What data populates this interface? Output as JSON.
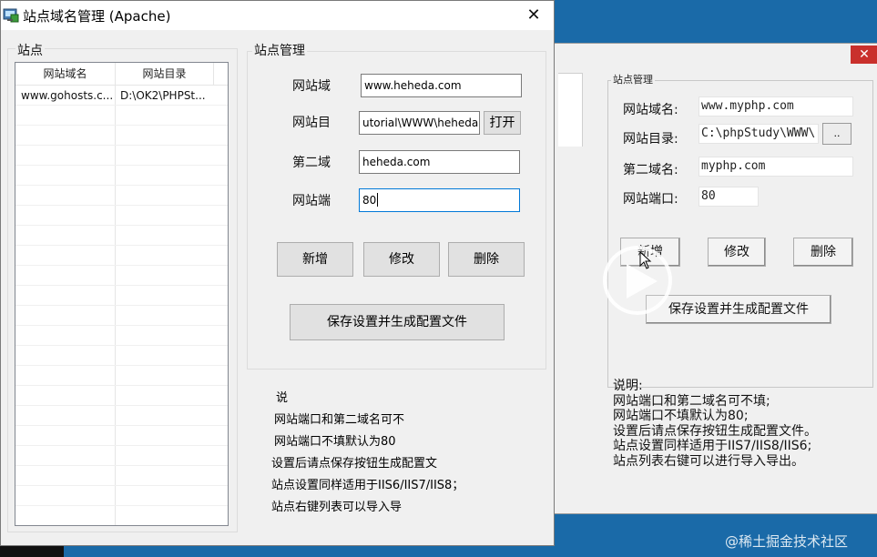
{
  "window": {
    "title": "站点域名管理 (Apache)"
  },
  "site_list": {
    "group_title": "站点",
    "columns": [
      "网站域名",
      "网站目录"
    ],
    "rows": [
      [
        "www.gohosts.c...",
        "D:\\OK2\\PHPSt..."
      ]
    ]
  },
  "site_manage": {
    "group_title": "站点管理",
    "domain_label": "网站域",
    "domain_value": "www.heheda.com",
    "dir_label": "网站目",
    "dir_value": "utorial\\WWW\\heheda",
    "open_button": "打开",
    "second_domain_label": "第二域",
    "second_domain_value": "heheda.com",
    "port_label": "网站端",
    "port_value": "80",
    "add_button": "新增",
    "edit_button": "修改",
    "delete_button": "删除",
    "save_button": "保存设置并生成配置文件"
  },
  "notes": [
    "说",
    "网站端口和第二域名可不",
    "网站端口不填默认为80",
    "设置后请点保存按钮生成配置文",
    "站点设置同样适用于IIS6/IIS7/IIS8；",
    "站点右键列表可以导入导"
  ],
  "background_window": {
    "group_title": "站点管理",
    "domain_label": "网站域名:",
    "domain_value": "www.myphp.com",
    "dir_label": "网站目录:",
    "dir_value": "C:\\phpStudy\\WWW\\",
    "browse_button": "..",
    "second_domain_label": "第二域名:",
    "second_domain_value": "myphp.com",
    "port_label": "网站端口:",
    "port_value": "80",
    "add_button": "新增",
    "edit_button": "修改",
    "delete_button": "删除",
    "save_button": "保存设置并生成配置文件",
    "notes": [
      "说明:",
      "网站端口和第二域名可不填;",
      "网站端口不填默认为80;",
      "设置后请点保存按钮生成配置文件。",
      "站点设置同样适用于IIS7/IIS8/IIS6;",
      "站点列表右键可以进行导入导出。"
    ]
  },
  "watermark": "@稀土掘金技术社区",
  "colors": {
    "desktop": "#1a6aa8",
    "dialog": "#f0f0f0",
    "focus_border": "#0078d7",
    "close_red": "#c9302c"
  },
  "icons": {
    "app": "app-icon",
    "close": "close-icon",
    "play": "play-icon",
    "cursor": "cursor-icon"
  }
}
